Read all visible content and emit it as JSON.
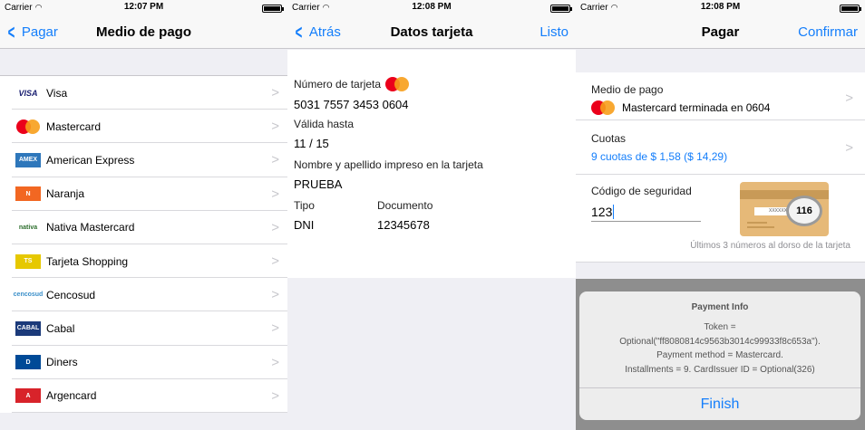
{
  "status": {
    "carrier": "Carrier",
    "wifi": "wifi-icon",
    "time1": "12:07 PM",
    "time2": "12:08 PM",
    "time3": "12:08 PM"
  },
  "screen1": {
    "title": "Medio de pago",
    "back_label": "Pagar",
    "items": [
      {
        "label": "Visa",
        "logo": "VISA",
        "color": "#1a1f71"
      },
      {
        "label": "Mastercard",
        "logo": "mc",
        "color": "#eb001b"
      },
      {
        "label": "American Express",
        "logo": "AMEX",
        "color": "#2e77bb"
      },
      {
        "label": "Naranja",
        "logo": "N",
        "color": "#f26722"
      },
      {
        "label": "Nativa Mastercard",
        "logo": "nativa",
        "color": "#2d6e2d"
      },
      {
        "label": "Tarjeta Shopping",
        "logo": "TS",
        "color": "#e6c800"
      },
      {
        "label": "Cencosud",
        "logo": "cencosud",
        "color": "#3a8fc9"
      },
      {
        "label": "Cabal",
        "logo": "CABAL",
        "color": "#1b3a7a"
      },
      {
        "label": "Diners",
        "logo": "D",
        "color": "#004a97"
      },
      {
        "label": "Argencard",
        "logo": "A",
        "color": "#d8232a"
      }
    ]
  },
  "screen2": {
    "title": "Datos tarjeta",
    "back_label": "Atrás",
    "done_label": "Listo",
    "card_number_label": "Número de tarjeta",
    "card_number": "5031 7557 3453 0604",
    "valid_label": "Válida hasta",
    "valid_value": "11 / 15",
    "name_label": "Nombre y apellido impreso en la tarjeta",
    "name_value": "PRUEBA",
    "tipo_label": "Tipo",
    "tipo_value": "DNI",
    "doc_label": "Documento",
    "doc_value": "12345678"
  },
  "screen3": {
    "title": "Pagar",
    "confirm_label": "Confirmar",
    "payment_method_label": "Medio de pago",
    "payment_method_value": "Mastercard terminada en 0604",
    "installments_label": "Cuotas",
    "installments_value": "9 cuotas de $ 1,58 ($ 14,29)",
    "security_label": "Código de seguridad",
    "security_value": "123",
    "card_cvv": "116",
    "card_stripe_text": "XXXXXX",
    "security_hint": "Últimos 3 números al dorso de la tarjeta",
    "accent_color": "#147efb"
  },
  "alert": {
    "title": "Payment Info",
    "line1": "Token =",
    "line2": "Optional(\"ff8080814c9563b3014c99933f8c653a\").",
    "line3": "Payment method = Mastercard.",
    "line4": "Installments = 9. CardIssuer ID = Optional(326)",
    "button": "Finish"
  }
}
